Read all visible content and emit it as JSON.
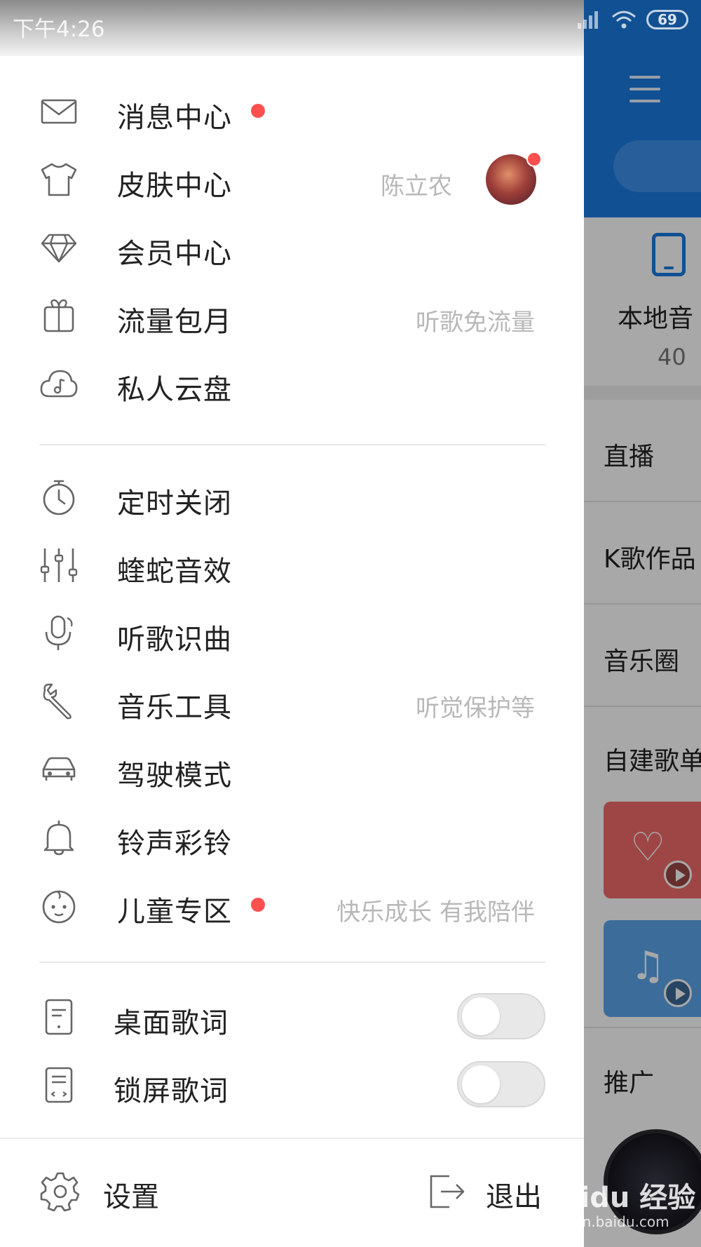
{
  "status_bar": {
    "time": "下午4:26",
    "battery": "69"
  },
  "drawer": {
    "items": [
      {
        "label": "消息中心",
        "hint": "",
        "dot": true
      },
      {
        "label": "皮肤中心",
        "hint": "陈立农",
        "dot": false
      },
      {
        "label": "会员中心",
        "hint": "",
        "dot": false
      },
      {
        "label": "流量包月",
        "hint": "听歌免流量",
        "dot": false
      },
      {
        "label": "私人云盘",
        "hint": "",
        "dot": false
      },
      {
        "label": "定时关闭",
        "hint": "",
        "dot": false
      },
      {
        "label": "蝰蛇音效",
        "hint": "",
        "dot": false
      },
      {
        "label": "听歌识曲",
        "hint": "",
        "dot": false
      },
      {
        "label": "音乐工具",
        "hint": "听觉保护等",
        "dot": false
      },
      {
        "label": "驾驶模式",
        "hint": "",
        "dot": false
      },
      {
        "label": "铃声彩铃",
        "hint": "",
        "dot": false
      },
      {
        "label": "儿童专区",
        "hint": "快乐成长 有我陪伴",
        "dot": true
      }
    ],
    "toggles": [
      {
        "label": "桌面歌词",
        "on": false
      },
      {
        "label": "锁屏歌词",
        "on": false
      }
    ],
    "bottom": {
      "settings": "设置",
      "exit": "退出"
    }
  },
  "background": {
    "local_music_title": "本地音",
    "local_music_count": "40",
    "rows": [
      "直播",
      "K歌作品",
      "音乐圈",
      "自建歌单",
      "推广"
    ]
  },
  "watermark": {
    "text": "Baidu 经验",
    "url": "jingyan.baidu.com"
  },
  "colors": {
    "accent_blue": "#1a7ae0",
    "dot_red": "#ff4f4f",
    "hint_gray": "#b8b8b8"
  }
}
